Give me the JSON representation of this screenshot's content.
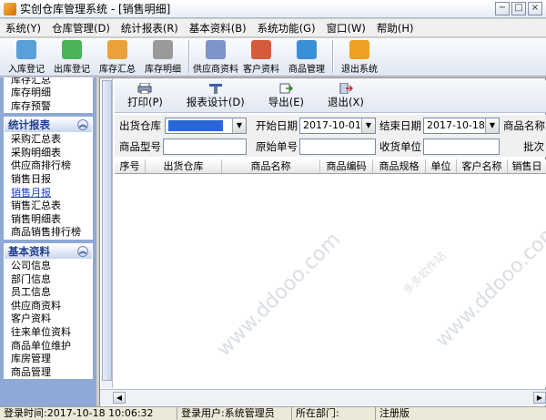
{
  "window": {
    "title": "实创仓库管理系统 - [销售明细]",
    "controls": [
      "−",
      "□",
      "×"
    ]
  },
  "menu": [
    "系统(Y)",
    "仓库管理(D)",
    "统计报表(R)",
    "基本资料(B)",
    "系统功能(G)",
    "窗口(W)",
    "帮助(H)"
  ],
  "toolbar": [
    {
      "label": "入库登记",
      "icon": "stock-in-icon",
      "color": "#5aa0d8"
    },
    {
      "label": "出库登记",
      "icon": "stock-out-icon",
      "color": "#4db35a"
    },
    {
      "label": "库存汇总",
      "icon": "inventory-summary-icon",
      "color": "#e9a23b"
    },
    {
      "label": "库存明细",
      "icon": "inventory-detail-icon",
      "color": "#9a9a9a"
    },
    {
      "label": "供应商资料",
      "icon": "supplier-icon",
      "color": "#7f93c9"
    },
    {
      "label": "客户资料",
      "icon": "customer-icon",
      "color": "#d65a3c"
    },
    {
      "label": "商品管理",
      "icon": "product-icon",
      "color": "#3b8fd6"
    },
    {
      "label": "退出系统",
      "icon": "exit-icon",
      "color": "#f0a020"
    }
  ],
  "nav": {
    "top_items": [
      "库存汇总",
      "库存明细",
      "库存预警"
    ],
    "groups": [
      {
        "title": "统计报表",
        "items": [
          "采购汇总表",
          "采购明细表",
          "供应商排行榜",
          "销售日报",
          "销售月报",
          "销售汇总表",
          "销售明细表",
          "商品销售排行榜"
        ],
        "link_index": 4
      },
      {
        "title": "基本资料",
        "items": [
          "公司信息",
          "部门信息",
          "员工信息",
          "供应商资料",
          "客户资料",
          "往来单位资料",
          "商品单位维护",
          "库房管理",
          "商品管理"
        ],
        "link_index": -1
      }
    ]
  },
  "subtoolbar": [
    {
      "label": "打印(P)",
      "icon": "printer-icon"
    },
    {
      "label": "报表设计(D)",
      "icon": "report-design-icon"
    },
    {
      "label": "导出(E)",
      "icon": "export-icon"
    },
    {
      "label": "退出(X)",
      "icon": "exit-icon"
    }
  ],
  "filters": {
    "warehouse_label": "出货仓库",
    "start_label": "开始日期",
    "start_value": "2017-10-01",
    "end_label": "结束日期",
    "end_value": "2017-10-18",
    "product_name_label": "商品名称",
    "model_label": "商品型号",
    "orig_no_label": "原始单号",
    "receiver_label": "收货单位",
    "batch_label": "批次"
  },
  "grid": {
    "columns": [
      "序号",
      "出货仓库",
      "商品名称",
      "商品编码",
      "商品规格",
      "单位",
      "客户名称",
      "销售日"
    ]
  },
  "watermarks": [
    "多多软件站",
    "www.ddooo.com",
    "www.ddooo.com"
  ],
  "status": {
    "login_time": "登录时间:2017-10-18 10:06:32",
    "user": "登录用户:系统管理员",
    "dept": "所在部门:",
    "edition": "注册版"
  }
}
